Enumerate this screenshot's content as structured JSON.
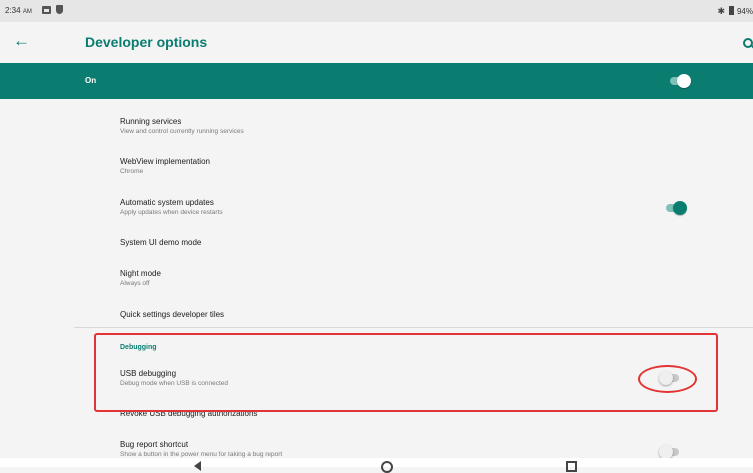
{
  "status_bar": {
    "time": "2:34",
    "ampm": "AM",
    "bluetooth": "✱",
    "battery_text": "94%"
  },
  "app_bar": {
    "title": "Developer options",
    "back_icon": "arrow-left-icon",
    "search_icon": "search-icon"
  },
  "master_switch": {
    "label": "On",
    "state": true
  },
  "items": [
    {
      "title": "Running services",
      "subtitle": "View and control currently running services"
    },
    {
      "title": "WebView implementation",
      "subtitle": "Chrome"
    },
    {
      "title": "Automatic system updates",
      "subtitle": "Apply updates when device restarts",
      "toggle": true
    },
    {
      "title": "System UI demo mode",
      "subtitle": ""
    },
    {
      "title": "Night mode",
      "subtitle": "Always off"
    },
    {
      "title": "Quick settings developer tiles",
      "subtitle": ""
    }
  ],
  "debugging": {
    "header": "Debugging",
    "items": [
      {
        "title": "USB debugging",
        "subtitle": "Debug mode when USB is connected",
        "toggle": false
      },
      {
        "title": "Revoke USB debugging authorizations",
        "subtitle": ""
      },
      {
        "title": "Bug report shortcut",
        "subtitle": "Show a button in the power menu for taking a bug report",
        "toggle": false
      }
    ]
  },
  "colors": {
    "accent": "#0a7d70",
    "annotation": "#e23434",
    "background": "#f4f4f4"
  }
}
